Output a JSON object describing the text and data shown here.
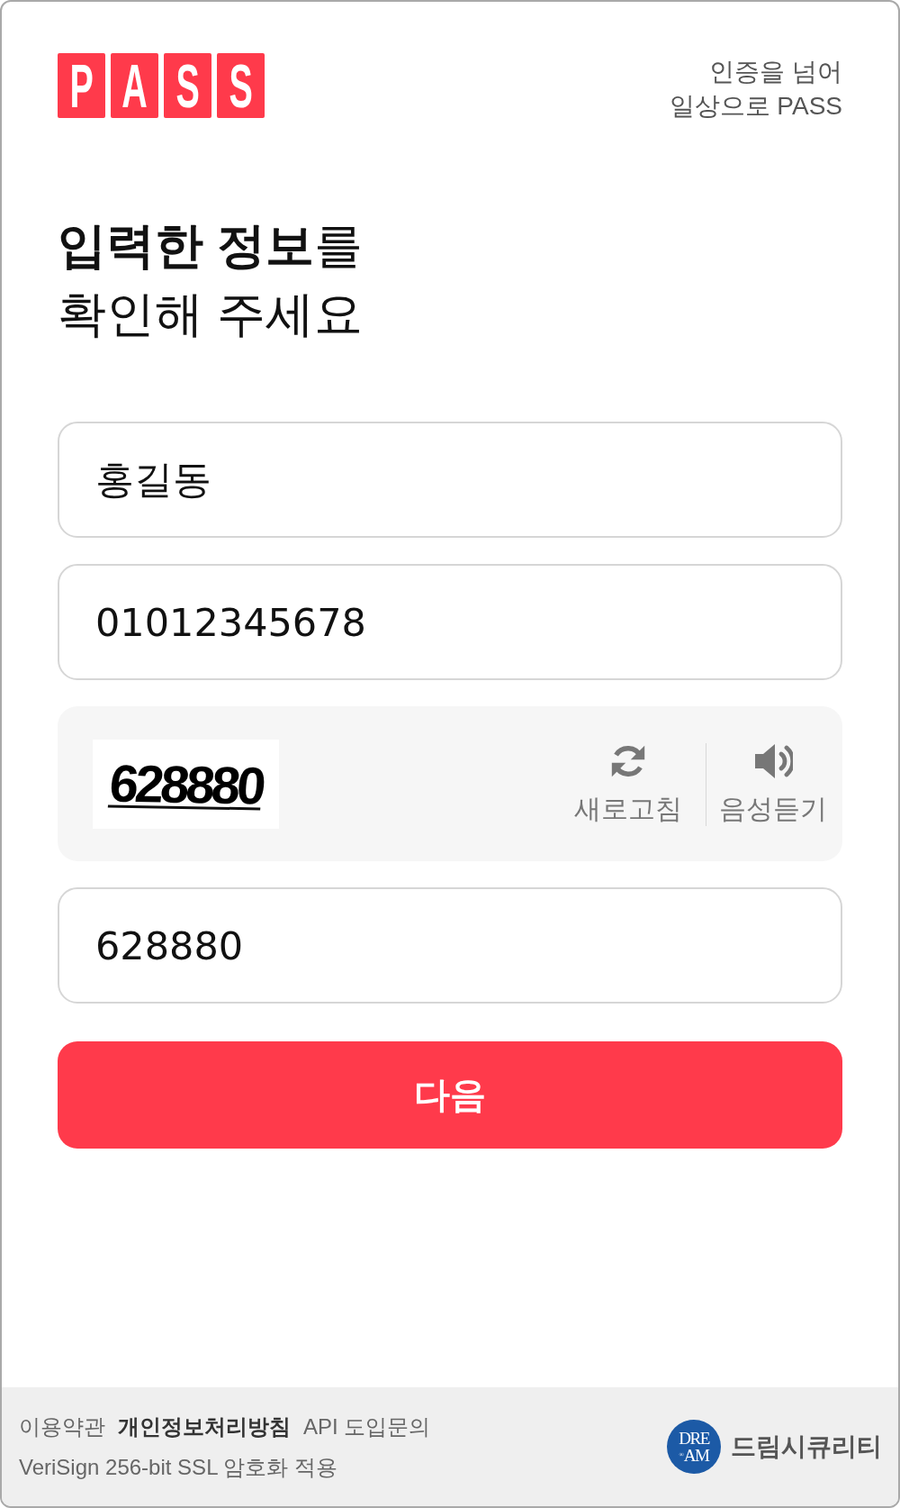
{
  "header": {
    "logo_letters": [
      "P",
      "A",
      "S",
      "S"
    ],
    "tagline_lines": [
      "인증을 넘어",
      "일상으로 PASS"
    ]
  },
  "title_lines": [
    "**입력한 정보**를",
    "확인해 주세요"
  ],
  "form": {
    "name_field": {
      "value": "홍길동"
    },
    "phone_field": {
      "value": "01012345678"
    },
    "captcha": {
      "image_text": "628880",
      "refresh_label": "새로고침",
      "audio_label": "음성듣기"
    },
    "code_field": {
      "value": "628880"
    },
    "submit_button": {
      "label": "다음"
    }
  },
  "footer": {
    "links": [
      {
        "label": "이용약관",
        "bold": false
      },
      {
        "label": "개인정보처리방침",
        "bold": true
      },
      {
        "label": "API 도입문의",
        "bold": false
      }
    ],
    "security_note": "VeriSign 256-bit SSL 암호화 적용",
    "brand": {
      "mark_lines": [
        "DRE",
        "$^{®}$AM"
      ],
      "name": "드림시큐리티"
    }
  }
}
